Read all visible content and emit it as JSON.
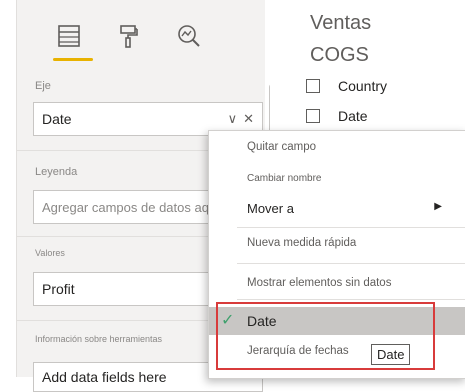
{
  "pane": {
    "sections": {
      "axis_label": "Eje",
      "legend_label": "Leyenda",
      "values_label": "Valores",
      "tooltips_label": "Información sobre herramientas"
    },
    "wells": {
      "axis_value": "Date",
      "legend_placeholder": "Agregar campos de datos aquí",
      "values_value": "Profit",
      "tooltips_value": "Add data fields here"
    },
    "icons": [
      "fields-icon",
      "format-paint-icon",
      "analytics-icon"
    ],
    "accent": "#e8b200"
  },
  "fields": {
    "tables": [
      "Ventas",
      "COGS"
    ],
    "items": [
      "Country",
      "Date"
    ]
  },
  "context_menu": {
    "items": [
      "Quitar campo",
      "Cambiar nombre",
      "Mover a",
      "Nueva medida rápida",
      "Mostrar elementos sin datos",
      "Date",
      "Jerarquía de fechas"
    ],
    "selected_check_color": "#3fa06d",
    "highlight_color": "#d83b3b"
  },
  "tooltip": "Date"
}
